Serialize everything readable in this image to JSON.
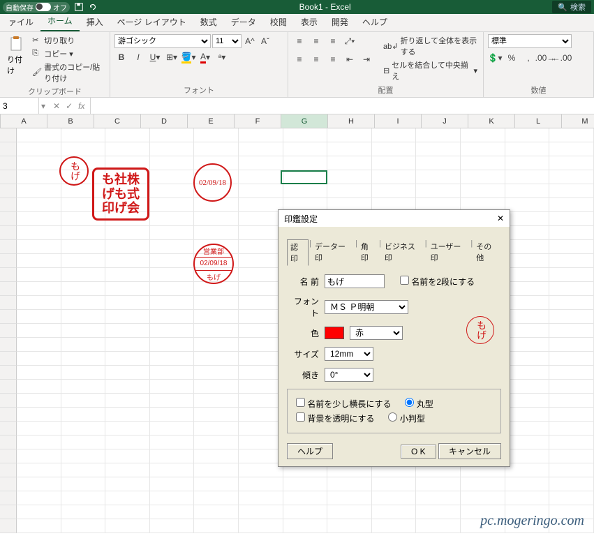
{
  "titlebar": {
    "autosave": "自動保存",
    "autosave_state": "オフ",
    "doc_title": "Book1 - Excel",
    "search_placeholder": "検索"
  },
  "ribbon_tabs": [
    "ァイル",
    "ホーム",
    "挿入",
    "ページ レイアウト",
    "数式",
    "データ",
    "校閲",
    "表示",
    "開発",
    "ヘルプ"
  ],
  "ribbon_active_tab": 1,
  "clipboard": {
    "paste": "り付け",
    "cut": "切り取り",
    "copy": "コピー",
    "format_painter": "書式のコピー/貼り付け",
    "group": "クリップボード"
  },
  "font": {
    "name": "游ゴシック",
    "size": "11",
    "group": "フォント"
  },
  "alignment": {
    "wrap": "折り返して全体を表示する",
    "merge": "セルを結合して中央揃え",
    "group": "配置"
  },
  "number": {
    "format": "標準",
    "group": "数値"
  },
  "name_box": "3",
  "columns": [
    "A",
    "B",
    "C",
    "D",
    "E",
    "F",
    "G",
    "H",
    "I",
    "J",
    "K",
    "L",
    "M"
  ],
  "active_col_index": 6,
  "selected_cell": {
    "col": 6,
    "row": 3
  },
  "stamps": {
    "small_circle": "もげ",
    "square_lines": "も社株\nげも式\n印げ会",
    "date_circle": "02/09/18",
    "triple_top": "営業部",
    "triple_mid": "02/09/18",
    "triple_bot": "もげ"
  },
  "dialog": {
    "title": "印鑑設定",
    "tabs": [
      "認印",
      "データー印",
      "角印",
      "ビジネス印",
      "ユーザー印",
      "その他"
    ],
    "active_tab": 0,
    "name_label": "名 前",
    "name_value": "もげ",
    "two_line": "名前を2段にする",
    "font_label": "フォント",
    "font_value": "ＭＳ Ｐ明朝",
    "color_label": "色",
    "color_value": "赤",
    "size_label": "サイズ",
    "size_value": "12mm",
    "tilt_label": "傾き",
    "tilt_value": "0°",
    "opt_wide": "名前を少し横長にする",
    "opt_transparent": "背景を透明にする",
    "shape_round": "丸型",
    "shape_oval": "小判型",
    "help": "ヘルプ",
    "ok": "O K",
    "cancel": "キャンセル",
    "preview": "もげ"
  },
  "watermark": "pc.mogeringo.com"
}
